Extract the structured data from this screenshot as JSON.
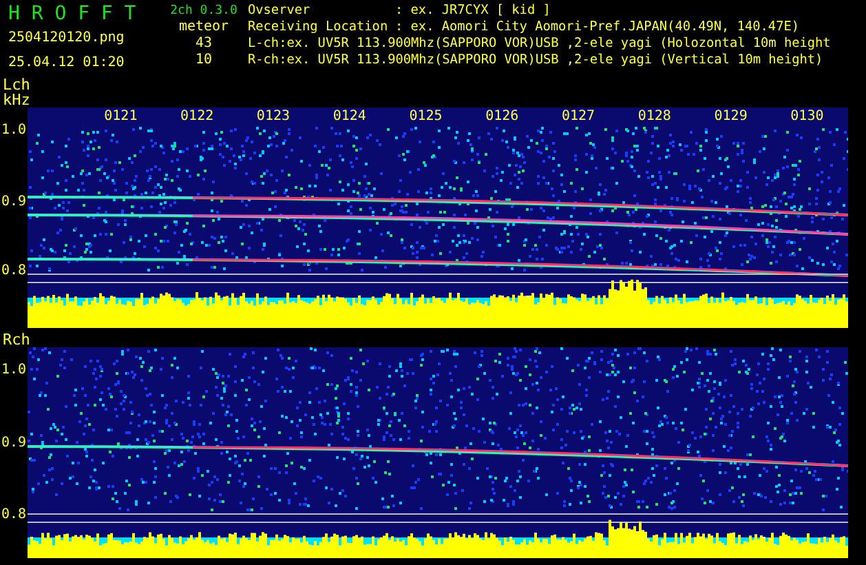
{
  "header": {
    "title": "H R O F F T",
    "version": "2ch 0.3.0",
    "filename": "2504120120.png",
    "datetime": "25.04.12 01:20",
    "mode": "meteor",
    "counts": [
      "43",
      "10"
    ]
  },
  "info": {
    "observer": {
      "label": "Ovserver",
      "value": ": ex. JR7CYX [ kid ]"
    },
    "location": {
      "label": "Receiving Location",
      "value": ": ex. Aomori City Aomori-Pref.JAPAN(40.49N, 140.47E)"
    },
    "channels": [
      "L-ch:ex. UV5R 113.900Mhz(SAPPORO VOR)USB ,2-ele yagi (Holozontal 10m height",
      "R-ch:ex. UV5R 113.900Mhz(SAPPORO VOR)USB ,2-ele yagi (Vertical 10m height)"
    ]
  },
  "panels": [
    {
      "label": "Lch",
      "unit": "kHz",
      "time_labels": [
        "0121",
        "0122",
        "0123",
        "0124",
        "0125",
        "0126",
        "0127",
        "0128",
        "0129",
        "0130"
      ],
      "freq_labels": [
        "1.0",
        "0.9",
        "0.8"
      ]
    },
    {
      "label": "Rch",
      "freq_labels": [
        "1.0",
        "0.9",
        "0.8"
      ]
    }
  ]
}
